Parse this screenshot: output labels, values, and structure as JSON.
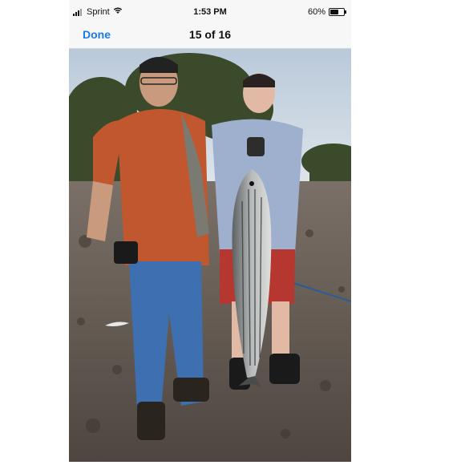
{
  "status_bar": {
    "carrier": "Sprint",
    "time": "1:53 PM",
    "battery_percent": "60%",
    "battery_level": 0.6,
    "signal_icon": "signal-bars-icon",
    "wifi_icon": "wifi-icon",
    "battery_icon": "battery-icon"
  },
  "nav": {
    "done_label": "Done",
    "counter": "15 of 16"
  },
  "photo": {
    "kind": "fishing-photo",
    "colors": {
      "sky": "#c9d6e3",
      "trees": "#3f4f2c",
      "ground": "#5c5249",
      "accent_link": "#1a7ce5"
    }
  }
}
